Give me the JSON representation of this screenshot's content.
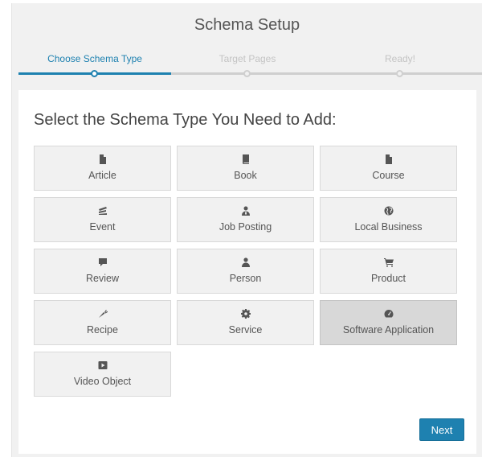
{
  "wizard": {
    "title": "Schema Setup",
    "steps": [
      {
        "label": "Choose Schema Type",
        "active": true
      },
      {
        "label": "Target Pages",
        "active": false
      },
      {
        "label": "Ready!",
        "active": false
      }
    ]
  },
  "main": {
    "heading": "Select the Schema Type You Need to Add:",
    "schema_types": [
      {
        "label": "Article",
        "icon": "file-icon"
      },
      {
        "label": "Book",
        "icon": "book-icon"
      },
      {
        "label": "Course",
        "icon": "file-icon"
      },
      {
        "label": "Event",
        "icon": "calendar-icon"
      },
      {
        "label": "Job Posting",
        "icon": "user-tie-icon"
      },
      {
        "label": "Local Business",
        "icon": "globe-icon"
      },
      {
        "label": "Review",
        "icon": "comment-icon"
      },
      {
        "label": "Person",
        "icon": "user-icon"
      },
      {
        "label": "Product",
        "icon": "cart-icon"
      },
      {
        "label": "Recipe",
        "icon": "carrot-icon"
      },
      {
        "label": "Service",
        "icon": "gear-icon"
      },
      {
        "label": "Software Application",
        "icon": "dashboard-icon",
        "selected": true
      },
      {
        "label": "Video Object",
        "icon": "video-icon"
      }
    ],
    "next_label": "Next"
  },
  "colors": {
    "accent": "#1e81b0",
    "card_bg": "#f1f1f1",
    "card_selected_bg": "#d8d8d8",
    "page_bg": "#f1f1f1"
  }
}
